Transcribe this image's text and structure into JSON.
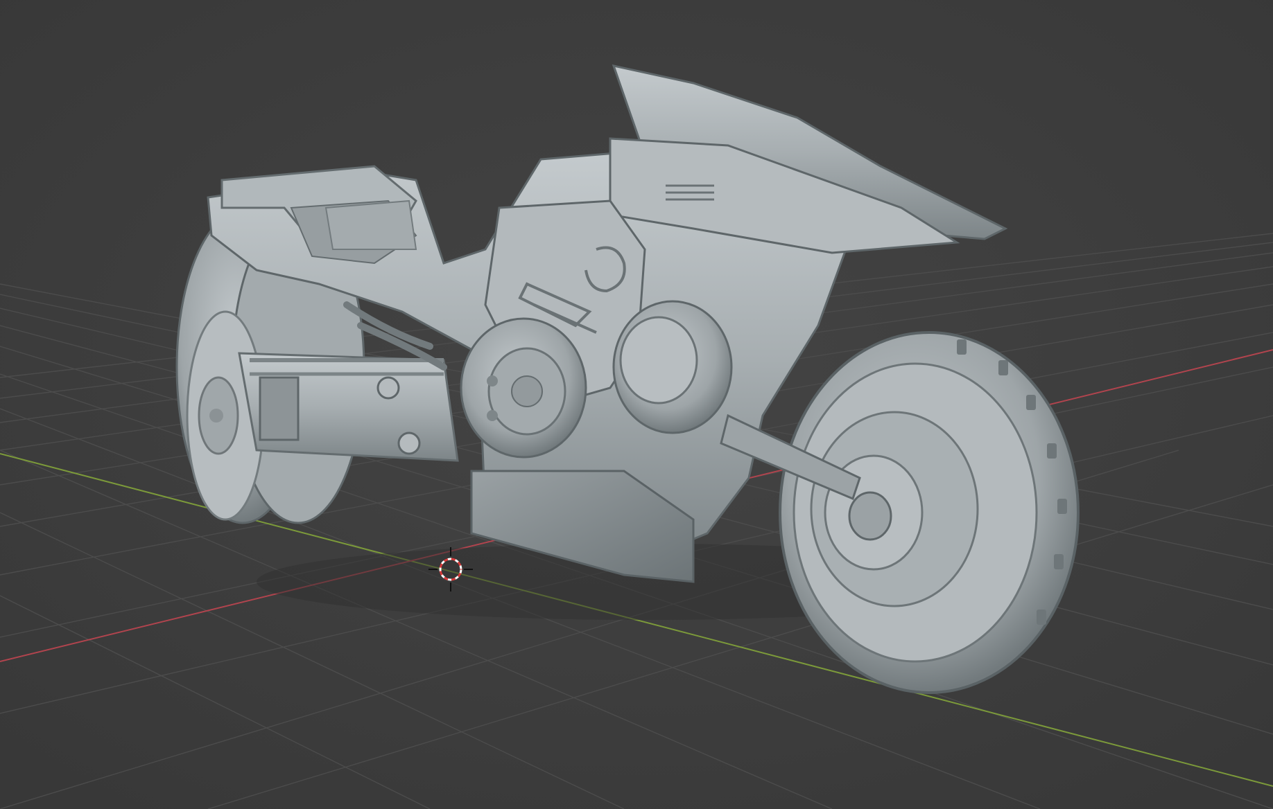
{
  "viewport": {
    "name": "3D viewport",
    "background": "#3d3d3d",
    "grid_color": "#4c4c4c",
    "x_axis_color": "#b2444e",
    "y_axis_color": "#7c9a3a",
    "model_color": "#a9b0b3",
    "cursor_color": "#d83a3a"
  },
  "scene": {
    "object": "motorcycle-sculpt",
    "shading": "solid",
    "cursor": "3d-cursor"
  }
}
